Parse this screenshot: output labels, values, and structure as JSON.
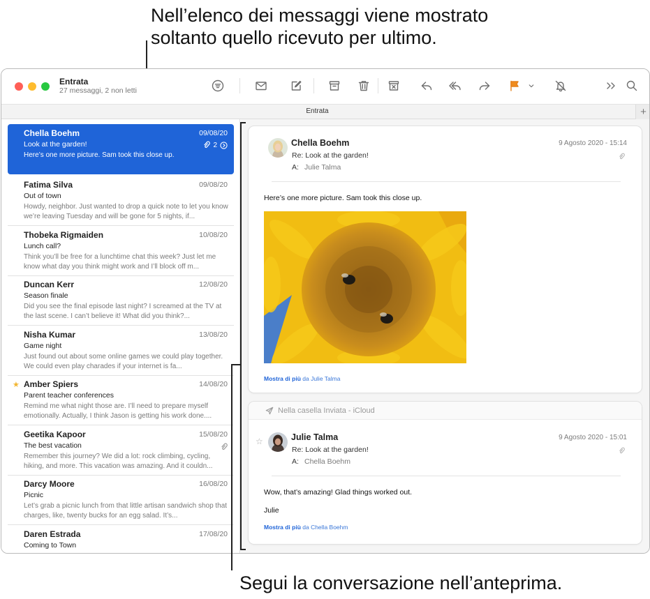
{
  "callouts": {
    "top": "Nell’elenco dei messaggi viene mostrato soltanto quello ricevuto per ultimo.",
    "bottom": "Segui la conversazione nell’anteprima."
  },
  "window": {
    "mailbox_title": "Entrata",
    "mailbox_subtitle": "27 messaggi, 2 non letti",
    "tab_label": "Entrata",
    "tab_add": "+"
  },
  "toolbar": {
    "icons": [
      "filter-icon",
      "envelope-icon",
      "compose-icon",
      "archive-icon",
      "trash-icon",
      "junk-icon",
      "reply-icon",
      "reply-all-icon",
      "forward-icon",
      "flag-icon",
      "chevron-down-icon",
      "mute-bell-icon",
      "more-icon",
      "search-icon"
    ],
    "flag_color": "#f08c1e"
  },
  "messages": [
    {
      "sender": "Chella Boehm",
      "date": "09/08/20",
      "subject": "Look at the garden!",
      "preview": "Here’s one more picture. Sam took this close up.",
      "thread_count": "2",
      "selected": true
    },
    {
      "sender": "Fatima Silva",
      "date": "09/08/20",
      "subject": "Out of town",
      "preview": "Howdy, neighbor. Just wanted to drop a quick note to let you know we’re leaving Tuesday and will be gone for 5 nights, if..."
    },
    {
      "sender": "Thobeka Rigmaiden",
      "date": "10/08/20",
      "subject": "Lunch call?",
      "preview": "Think you’ll be free for a lunchtime chat this week? Just let me know what day you think might work and I’ll block off m..."
    },
    {
      "sender": "Duncan Kerr",
      "date": "12/08/20",
      "subject": "Season finale",
      "preview": "Did you see the final episode last night? I screamed at the TV at the last scene. I can’t believe it! What did you think?..."
    },
    {
      "sender": "Nisha Kumar",
      "date": "13/08/20",
      "subject": "Game night",
      "preview": "Just found out about some online games we could play together. We could even play charades if your internet is fa..."
    },
    {
      "sender": "Amber Spiers",
      "date": "14/08/20",
      "subject": "Parent teacher conferences",
      "preview": "Remind me what night those are. I’ll need to prepare myself emotionally. Actually, I think Jason is getting his work done....",
      "starred": true
    },
    {
      "sender": "Geetika Kapoor",
      "date": "15/08/20",
      "subject": "The best vacation",
      "preview": "Remember this journey? We did a lot: rock climbing, cycling, hiking, and more. This vacation was amazing. And it couldn...",
      "attachment": true
    },
    {
      "sender": "Darcy Moore",
      "date": "16/08/20",
      "subject": "Picnic",
      "preview": "Let’s grab a picnic lunch from that little artisan sandwich shop that charges, like, twenty bucks for an egg salad. It’s..."
    },
    {
      "sender": "Daren Estrada",
      "date": "17/08/20",
      "subject": "Coming to Town",
      "preview": ""
    }
  ],
  "conversation": {
    "card1": {
      "sender": "Chella Boehm",
      "date": "9 Agosto 2020 - 15:14",
      "subject": "Re: Look at the garden!",
      "to_label": "A:",
      "to": "Julie Talma",
      "body": "Here’s one more picture. Sam took this close up.",
      "more_bold": "Mostra di più",
      "more_rest": " da Julie Talma"
    },
    "card2": {
      "sent_label": "Nella casella Inviata - iCloud",
      "sender": "Julie Talma",
      "date": "9 Agosto 2020 - 15:01",
      "subject": "Re: Look at the garden!",
      "to_label": "A:",
      "to": "Chella Boehm",
      "body1": "Wow, that’s amazing! Glad things worked out.",
      "body2": "Julie",
      "more_bold": "Mostra di più",
      "more_rest": " da Chella Boehm"
    }
  },
  "colors": {
    "selection": "#1f64d8",
    "link": "#1f64d8",
    "star": "#f2b632"
  }
}
